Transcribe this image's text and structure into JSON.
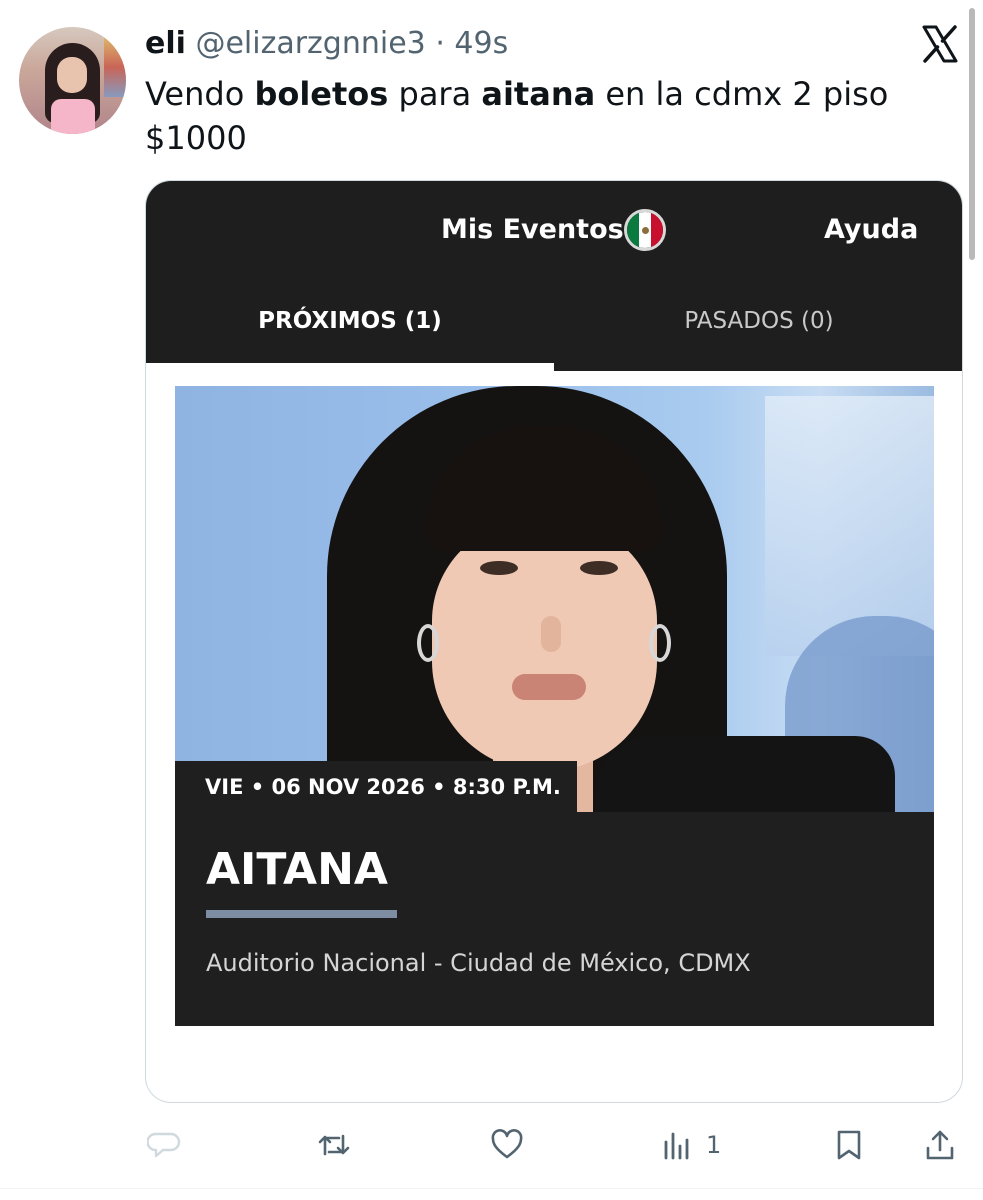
{
  "user": {
    "display_name": "eli",
    "handle": "@elizarzgnnie3",
    "separator": "·",
    "time": "49s"
  },
  "tweet": {
    "text_part1": "Vendo ",
    "text_bold1": "boletos",
    "text_part2": " para ",
    "text_bold2": "aitana",
    "text_part3": " en la cdmx 2 piso $1000"
  },
  "ticket_app": {
    "nav": {
      "my_events_label": "Mis Eventos",
      "help_label": "Ayuda",
      "country_flag_icon": "mexico-flag-icon"
    },
    "tabs": [
      {
        "label": "PRÓXIMOS (1)",
        "selected": true
      },
      {
        "label": "PASADOS (0)",
        "selected": false
      }
    ],
    "event": {
      "date_time": "VIE • 06 NOV 2026 • 8:30 P.M.",
      "title": "AITANA",
      "venue": "Auditorio Nacional - Ciudad de México, CDMX"
    }
  },
  "actions": {
    "reply_icon": "reply-icon",
    "retweet_icon": "retweet-icon",
    "like_icon": "heart-icon",
    "views_icon": "views-icon",
    "views_count": "1",
    "bookmark_icon": "bookmark-icon",
    "share_icon": "share-icon"
  },
  "colors": {
    "app_bar": "#1e1e1e",
    "event_block": "#1f1f1f",
    "title_underline": "#7f8da3",
    "text_secondary": "#536471"
  }
}
